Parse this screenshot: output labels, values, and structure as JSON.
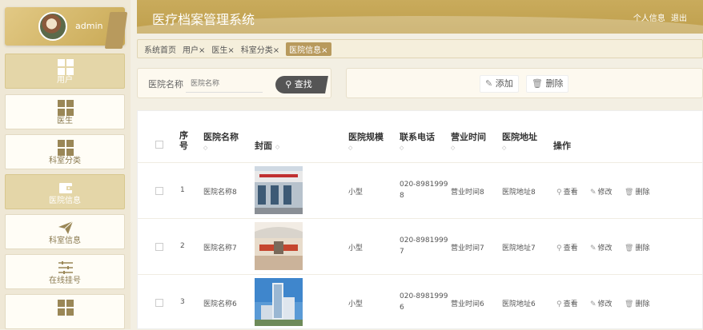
{
  "sidebar": {
    "user": "admin",
    "items": [
      {
        "label": "用户",
        "icon": "grid-icon",
        "active": true
      },
      {
        "label": "医生",
        "icon": "grid-icon",
        "active": false
      },
      {
        "label": "科室分类",
        "icon": "grid-icon",
        "active": false
      },
      {
        "label": "医院信息",
        "icon": "wallet-icon",
        "active": true
      },
      {
        "label": "科室信息",
        "icon": "paper-plane-icon",
        "active": false
      },
      {
        "label": "在线挂号",
        "icon": "sliders-icon",
        "active": false
      },
      {
        "label": "",
        "icon": "grid-icon",
        "active": false
      }
    ]
  },
  "header": {
    "title": "医疗档案管理系统",
    "profile": "个人信息",
    "logout": "退出"
  },
  "tabs": [
    {
      "label": "系统首页"
    },
    {
      "label": "用户×"
    },
    {
      "label": "医生×"
    },
    {
      "label": "科室分类×"
    },
    {
      "label": "医院信息×",
      "active": true
    }
  ],
  "search": {
    "label": "医院名称",
    "placeholder": "医院名称",
    "button": "查找"
  },
  "actions": {
    "add": "添加",
    "delete": "删除"
  },
  "table": {
    "headers": {
      "no": "序号",
      "name": "医院名称",
      "cover": "封面",
      "scale": "医院规模",
      "phone": "联系电话",
      "hours": "营业时间",
      "address": "医院地址",
      "ops": "操作"
    },
    "sort_symbol": "◇",
    "op_view": "查看",
    "op_edit": "修改",
    "op_delete": "删除",
    "rows": [
      {
        "no": "1",
        "name": "医院名称8",
        "scale": "小型",
        "phone1": "020-8981999",
        "phone2": "8",
        "hours": "营业时间8",
        "address": "医院地址8"
      },
      {
        "no": "2",
        "name": "医院名称7",
        "scale": "小型",
        "phone1": "020-8981999",
        "phone2": "7",
        "hours": "营业时间7",
        "address": "医院地址7"
      },
      {
        "no": "3",
        "name": "医院名称6",
        "scale": "小型",
        "phone1": "020-8981999",
        "phone2": "6",
        "hours": "营业时间6",
        "address": "医院地址6"
      }
    ]
  }
}
